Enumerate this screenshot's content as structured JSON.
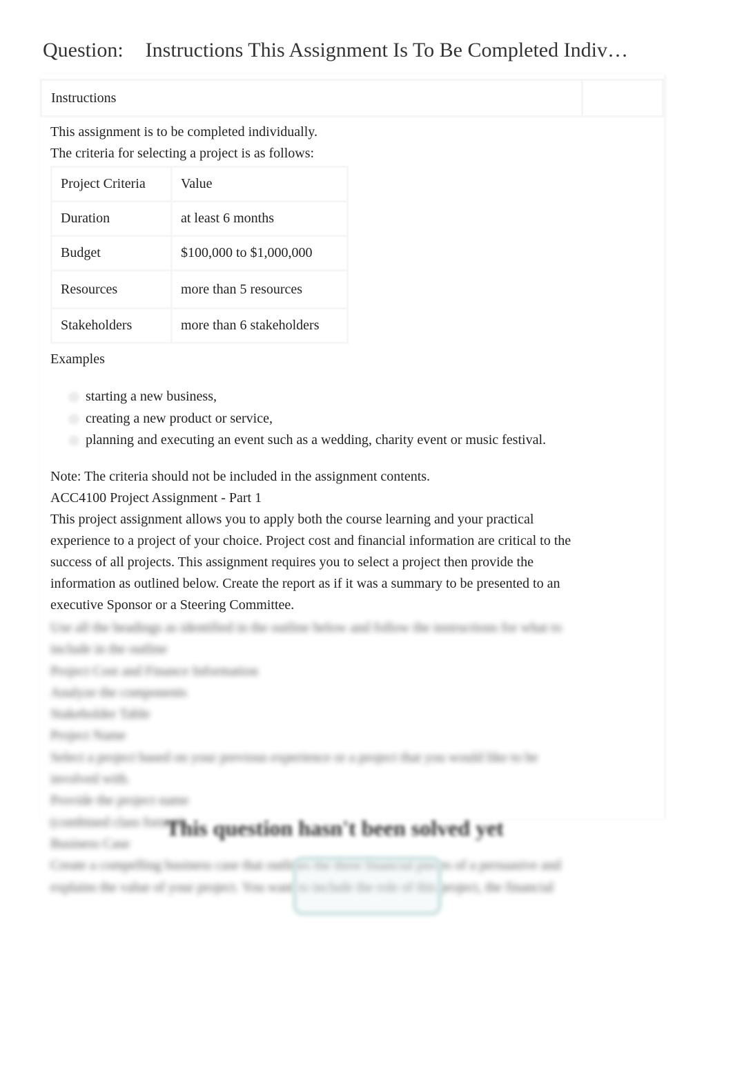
{
  "header": {
    "label": "Question:",
    "title": "Instructions This Assignment Is To Be Completed Indiv…"
  },
  "card": {
    "header_label": "Instructions"
  },
  "intro": [
    "This assignment is to be completed individually.",
    "The criteria for selecting a project is as follows:"
  ],
  "criteria_table": {
    "columns": [
      "Project Criteria",
      "Value"
    ],
    "rows": [
      [
        "Duration",
        "at least 6 months"
      ],
      [
        "Budget",
        "$100,000 to $1,000,000"
      ],
      [
        "Resources",
        "more than 5 resources"
      ],
      [
        "Stakeholders",
        "more than 6 stakeholders"
      ]
    ]
  },
  "examples": {
    "label": "Examples",
    "items": [
      "starting a new business,",
      "creating a new product or service,",
      "planning and executing an event such as a wedding, charity event or music festival."
    ]
  },
  "note": "Note: The criteria should not be included in the assignment contents.",
  "assignment_title": "ACC4100 Project Assignment - Part 1",
  "assignment_paragraph_lines": [
    "This project assignment allows you to apply both the course learning and your practical",
    "experience to a project of your choice. Project cost and financial information are critical to the",
    "success of all projects. This assignment requires you to select a project then provide the",
    "information as outlined below. Create the report as if it was a summary to be presented to an",
    "executive Sponsor or a Steering Committee."
  ],
  "blurred_lines": [
    "Use all the headings as identified in the outline below and follow the instructions for what to",
    "include in the outline",
    "Project Cost and Finance Information",
    "Analyze the components",
    "Stakeholder Table",
    "Project Name",
    "Select a project based on your previous experience or a project that you would like to be",
    "involved with.",
    "Provide the project name",
    "(combined class format)",
    "Business Case",
    "Create a compelling business case that outlines the three financial pieces of a persuasive and",
    "explains the value of your project. You want to include the role of this project, the financial"
  ],
  "overlay": {
    "title": "This question hasn't been solved yet",
    "button_label": ""
  }
}
